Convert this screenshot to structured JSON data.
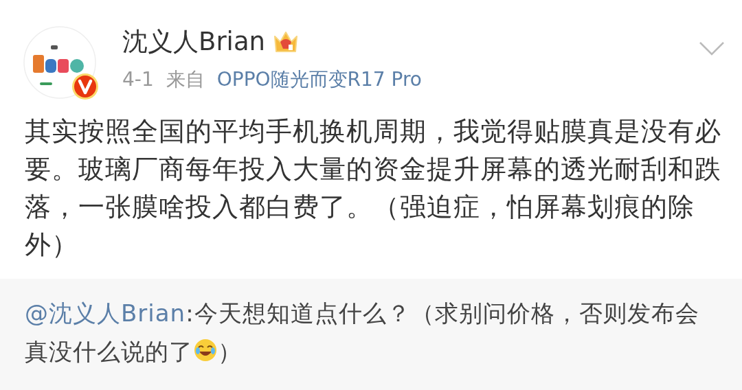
{
  "post": {
    "author": "沈义人Brian",
    "date": "4-1",
    "source_prefix": "来自",
    "source": "OPPO随光而变R17 Pro",
    "verified": true,
    "text": "其实按照全国的平均手机换机周期，我觉得贴膜真是没有必要。玻璃厂商每年投入大量的资金提升屏幕的透光耐刮和跌落，一张膜啥投入都白费了。（强迫症，怕屏幕划痕的除外）"
  },
  "quoted": {
    "mention": "@沈义人Brian",
    "text_before_emoji": ":今天想知道点什么？（求别问价格，否则发布会真没什么说的了",
    "text_after_emoji": "）"
  }
}
